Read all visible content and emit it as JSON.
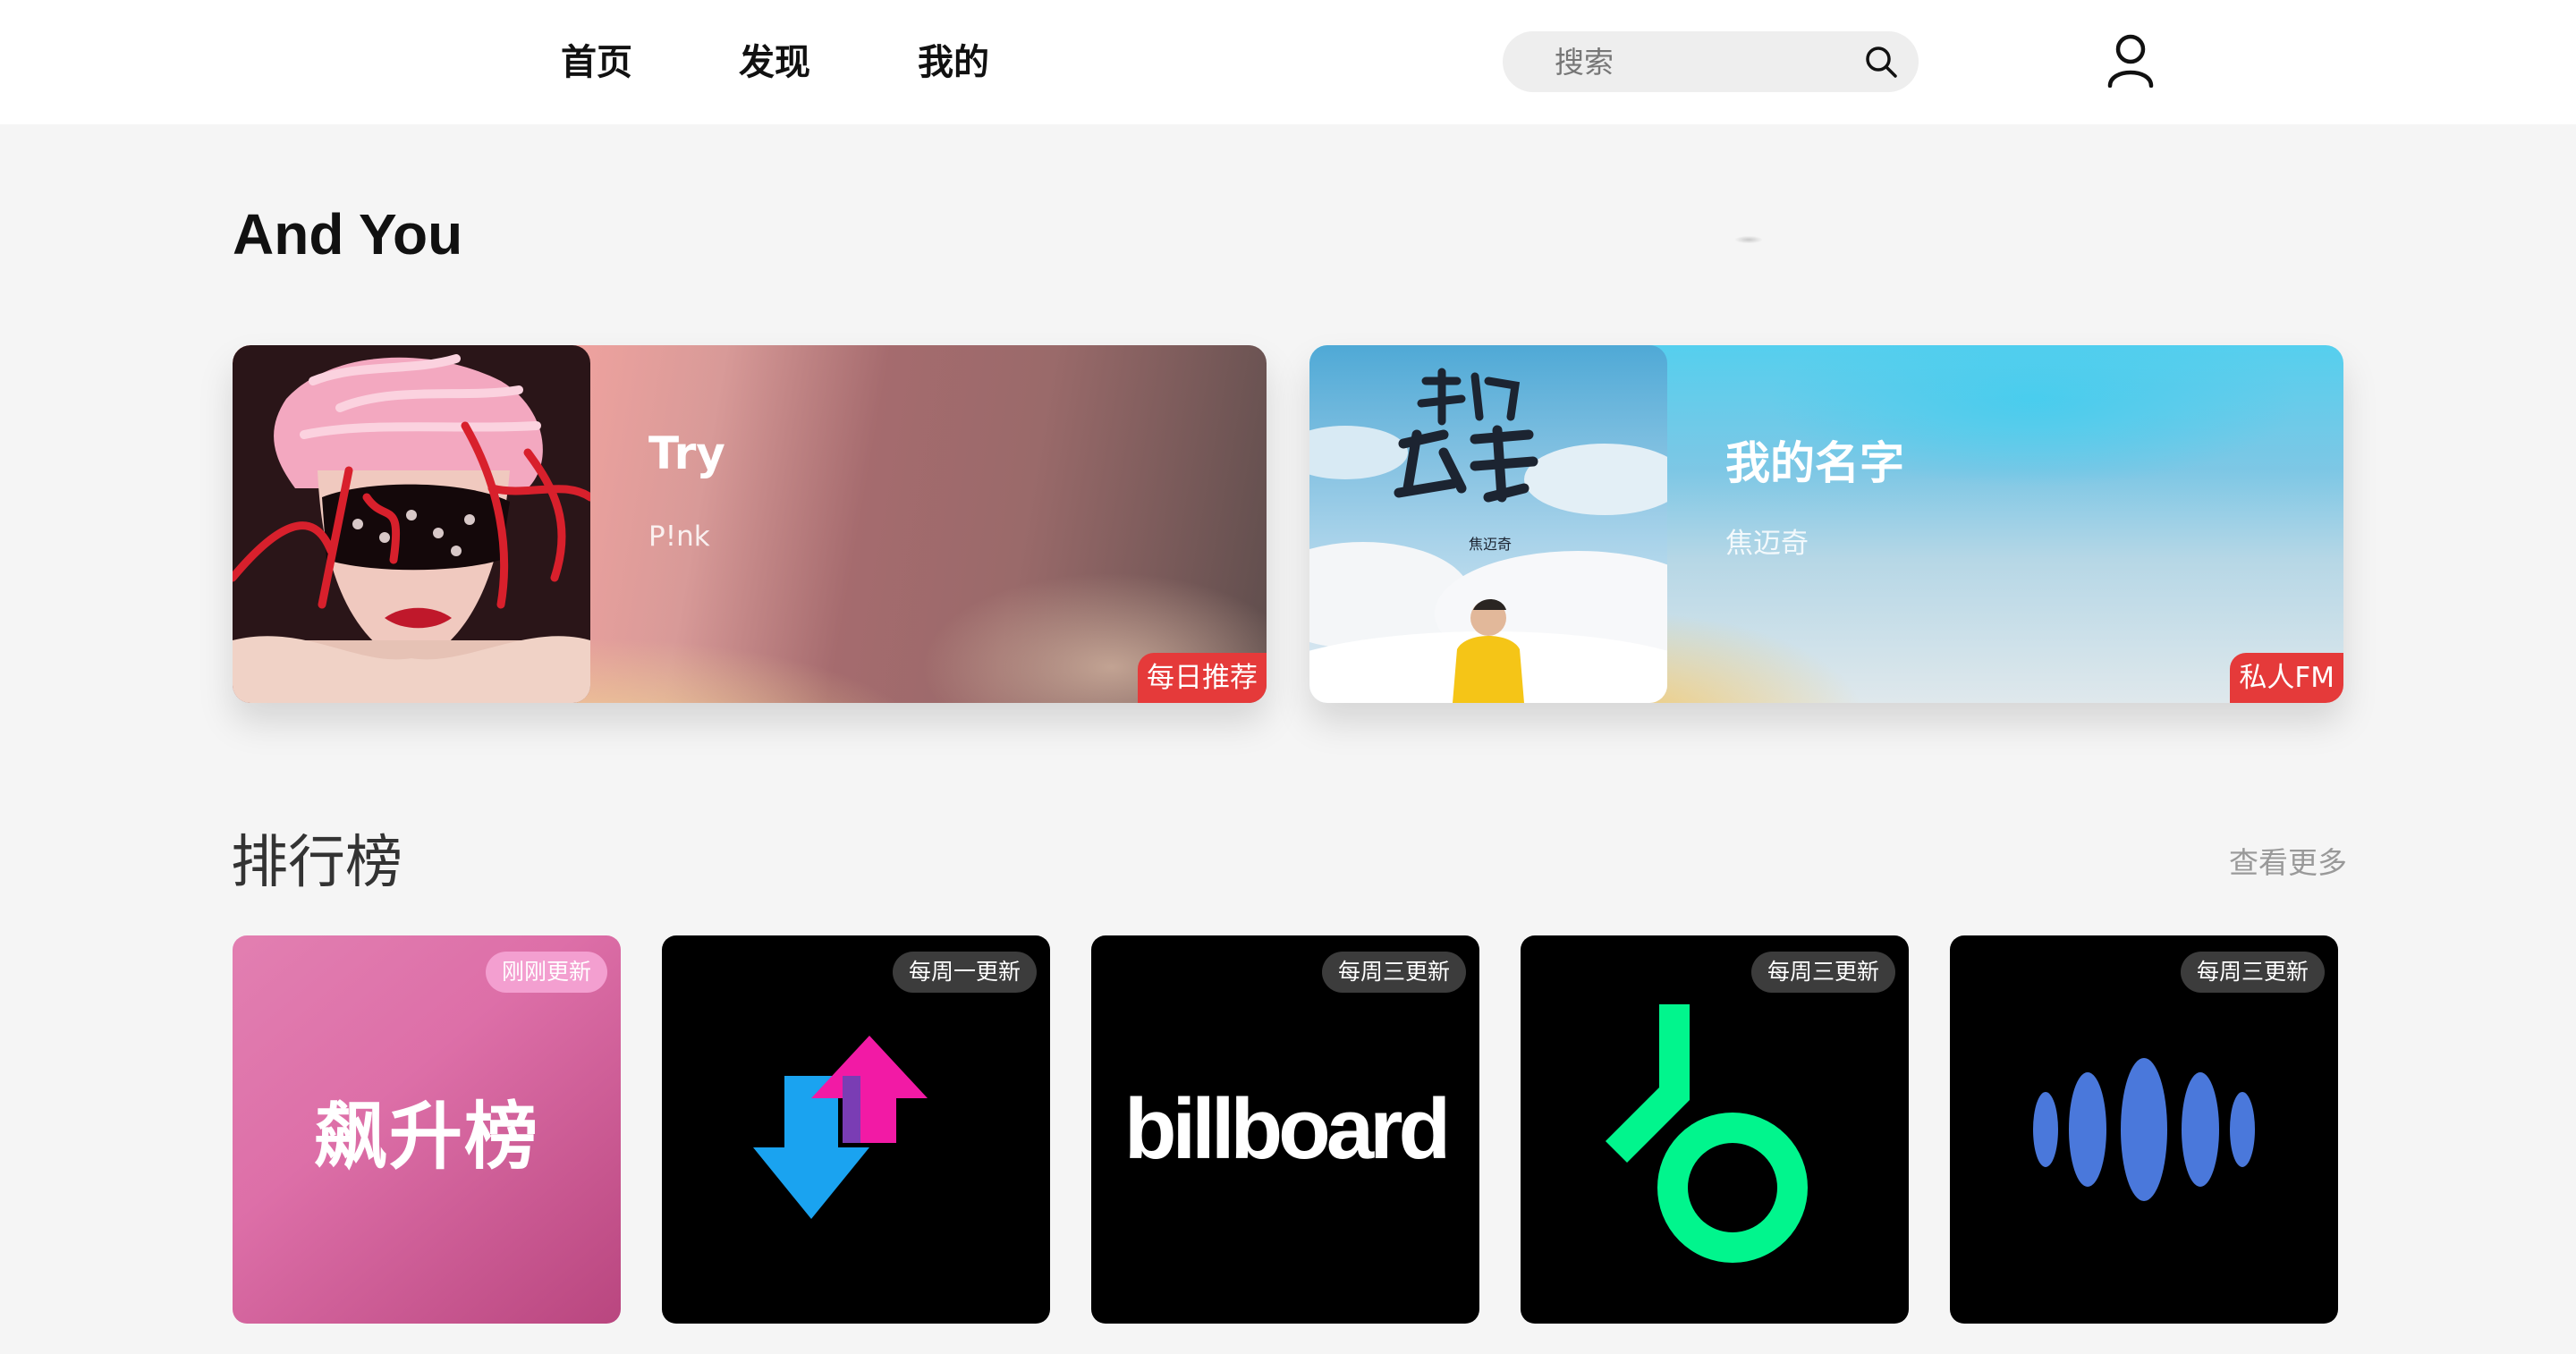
{
  "nav": {
    "items": [
      {
        "label": "首页"
      },
      {
        "label": "发现"
      },
      {
        "label": "我的"
      }
    ],
    "search_placeholder": "搜索",
    "search_icon": "search-icon",
    "user_icon": "user-icon"
  },
  "for_you": {
    "title": "And You",
    "cards": [
      {
        "title": "Try",
        "artist": "P!nk",
        "badge": "每日推荐"
      },
      {
        "title": "我的名字",
        "artist": "焦迈奇",
        "badge": "私人FM"
      }
    ]
  },
  "charts": {
    "title": "排行榜",
    "more_label": "查看更多",
    "items": [
      {
        "name": "飙升榜",
        "badge": "刚刚更新"
      },
      {
        "name": "up-down-arrows-logo",
        "badge": "每周一更新"
      },
      {
        "name": "billboard",
        "badge": "每周三更新"
      },
      {
        "name": "beatport-logo",
        "badge": "每周三更新"
      },
      {
        "name": "sound-wave-logo",
        "badge": "每周三更新"
      }
    ]
  },
  "colors": {
    "accent_red": "#e53a3a",
    "badge_pink": "#f39fd0",
    "badge_dark": "#3c3c3c",
    "logo_green": "#01f58d",
    "logo_blue": "#4a78db"
  }
}
